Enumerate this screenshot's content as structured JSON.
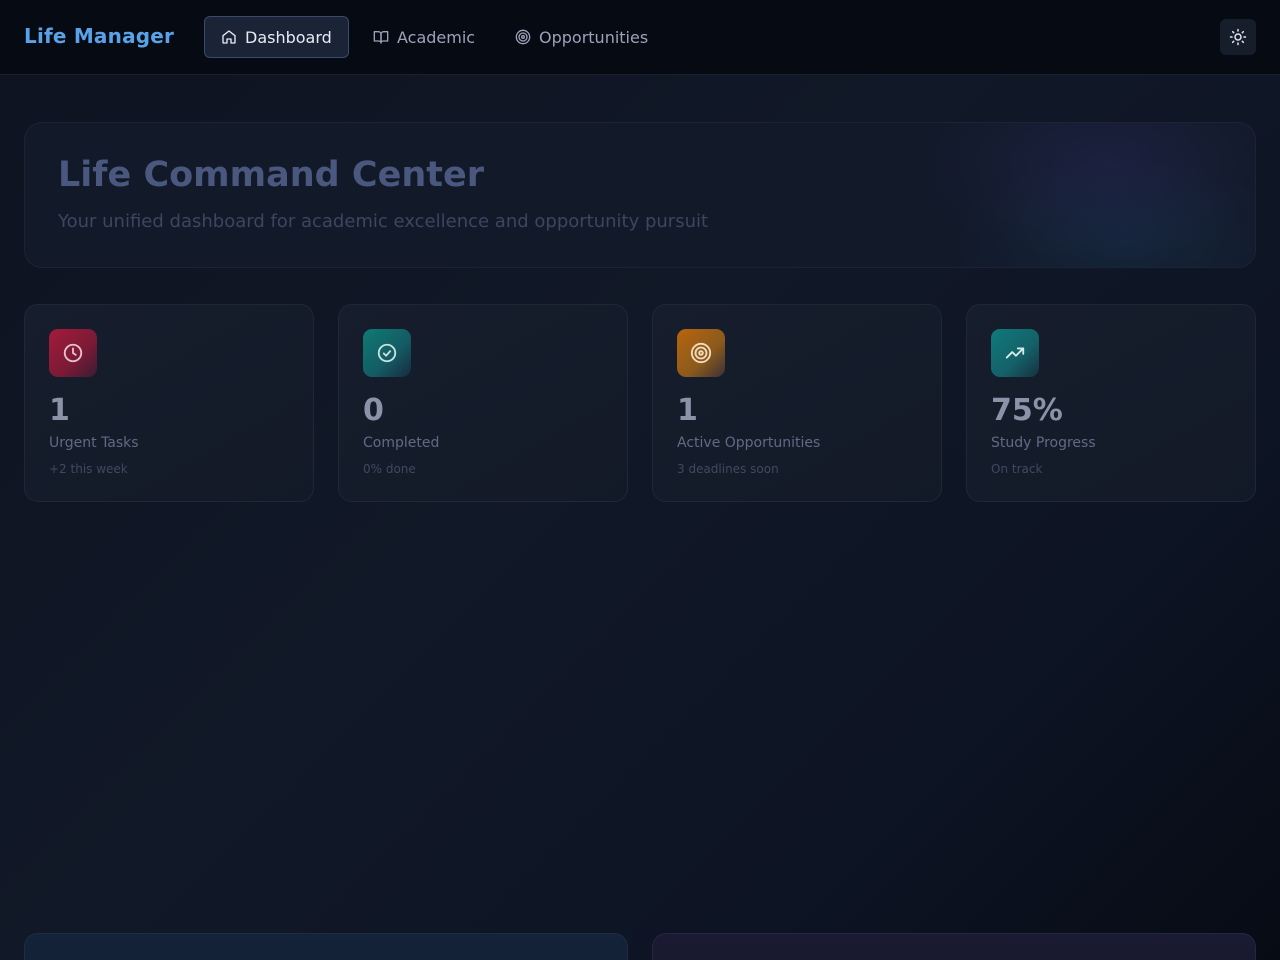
{
  "app": {
    "title": "Life Manager"
  },
  "nav": {
    "items": [
      {
        "label": "Dashboard",
        "icon": "home-icon",
        "active": true
      },
      {
        "label": "Academic",
        "icon": "book-open-icon",
        "active": false
      },
      {
        "label": "Opportunities",
        "icon": "target-icon",
        "active": false
      }
    ],
    "theme_toggle_icon": "sun-icon"
  },
  "hero": {
    "title": "Life Command Center",
    "subtitle": "Your unified dashboard for academic excellence and opportunity pursuit"
  },
  "stats": [
    {
      "icon": "clock-icon",
      "value": "1",
      "label": "Urgent Tasks",
      "note": "+2 this week",
      "accent": "#be123c"
    },
    {
      "icon": "check-circle-icon",
      "value": "0",
      "label": "Completed",
      "note": "0% done",
      "accent": "#0f766e"
    },
    {
      "icon": "target-icon",
      "value": "1",
      "label": "Active Opportunities",
      "note": "3 deadlines soon",
      "accent": "#b45309"
    },
    {
      "icon": "trending-up-icon",
      "value": "75%",
      "label": "Study Progress",
      "note": "On track",
      "accent": "#0f766e"
    }
  ],
  "colors": {
    "brand": "#5aa2e8",
    "background": "#111827",
    "topbar": "#060a13"
  }
}
